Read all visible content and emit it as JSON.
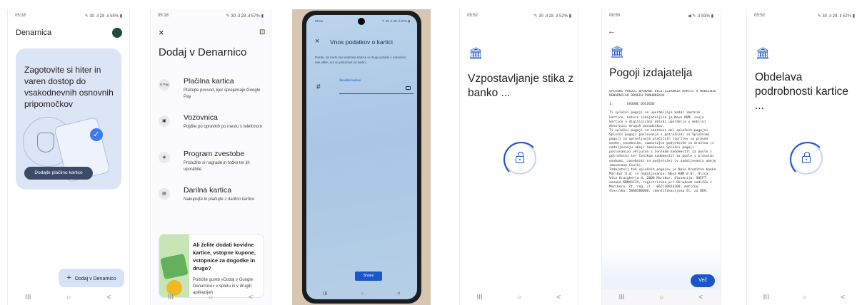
{
  "screen1": {
    "time": "05:18",
    "status_icons": "✎ 30 .il 28 .il 58% ▮",
    "app_title": "Denarnica",
    "hero_text": "Zagotovite si hiter in varen dostop do vsakodnevnih osnovnih pripomočkov",
    "hero_button": "Dodajte plačilno kartico",
    "fab_label": "Dodaj v Denarnico",
    "fab_icon": "+",
    "nav": [
      "III",
      "○",
      "<"
    ]
  },
  "screen2": {
    "time": "05:18",
    "status_icons": "✎ 30 .il 28 .il 57% ▮",
    "close": "×",
    "feedback_icon": "⊡",
    "title": "Dodaj v Denarnico",
    "options": [
      {
        "icon": "G Pay",
        "title": "Plačilna kartica",
        "desc": "Plačujte povsod, kjer sprejemajo Google Pay"
      },
      {
        "icon": "▣",
        "title": "Vozovnica",
        "desc": "Pojdite po opravkih po mestu s telefonom"
      },
      {
        "icon": "◈",
        "title": "Program zvestobe",
        "desc": "Prislužite si nagrade in točke ter jih uporabite"
      },
      {
        "icon": "▤",
        "title": "Darilna kartica",
        "desc": "Nakupujte in plačujte z darilno kartico"
      }
    ],
    "promo_title": "Ali želite dodati kovidne kartice, vstopne kupone, vstopnice za dogodke in drugo?",
    "promo_desc": "Poiščite gumb »Dodaj v Google Denarnico« v spletu in v drugih aplikacijah",
    "nav": [
      "III",
      "○",
      "<"
    ]
  },
  "screen3": {
    "time": "05:51",
    "status_icons": "✎ 30 .il 28 .il 57% ▮",
    "close": "×",
    "title": "Vnos podatkov o kartici",
    "desc": "Pazite, da bodo ime imetnika kartice in drugi podatki v natančno taki obliki, kot so prikazani na kartici.",
    "field_label": "Številka kartice",
    "hash": "#",
    "button": "Shrani",
    "nav": [
      "III",
      "○",
      "<"
    ]
  },
  "screen4": {
    "time": "05:52",
    "status_icons": "✎ 30 .il 28 .il 52% ▮",
    "bank_icon": "🏛",
    "title": "Vzpostavljanje stika z banko ...",
    "nav": [
      "III",
      "○",
      "<"
    ]
  },
  "screen5": {
    "time": "08:59",
    "status_icons": "◀ ✎ .il 83% ▮",
    "back": "←",
    "bank_icon": "🏛",
    "title": "Pogoji izdajatelja",
    "terms_heading": "SPLOŠNI POGOJI UPORABE DIGITIZIRANIH KARTIC V MOBILNIH DENARNICAH DRUGIH PONUDNIKOV",
    "terms_section": "1.       UVODNE DOLOČBE",
    "terms_body": "Ti splošni pogoji se uporabljajo kadar imetnik kartice, katere izdajateljica je Nova KBM, svojo kartico v digitizirani obliki uporablja v mobilni denarnici drugih ponudnikov.\nTi splošni pogoji so sestavni del splošnih pogojev Splošni pogoji poslovanja s potrošniki in Splošnimi pogoji za opravljanje plačilnih storitev za pravne osebe, zasebnike, samostojne podjetnike in društva (v nadaljevanju oboji imenovani Splošni pogoji poslovanja) vključno s Cenikom nadomestil za posle s potrošniki ter Cenikom nadomestil za posle s pravnimi osebami, zasebniki in podjetniki (v nadaljevanju oboje imenovano Cenik).\nIzdajatelj teh splošnih pogojev je Nova Kreditna banka Maribor d.d. (v nadaljevanju: Nova KBM d.d), Ulica Vita Kraigherja 4, 2000 Maribor, Slovenija, SWIFT oznaka KBMASI2X, registrirana pri Okrožnem sodišču v Mariboru, št. reg. vl.: 062/10924200, matična številka: 5860580000, identifikacijska št. za DDV:",
    "more_button": "Več",
    "nav": [
      "III",
      "○",
      "<"
    ]
  },
  "screen6": {
    "time": "05:52",
    "status_icons": "✎ 30 .il 28 .il 52% ▮",
    "bank_icon": "🏛",
    "title": "Obdelava podrobnosti kartice ...",
    "nav": [
      "III",
      "○",
      "<"
    ]
  },
  "colors": {
    "accent": "#1a56c8",
    "hero_bg": "#dbe5f6",
    "fab_bg": "#d6e2f8"
  }
}
